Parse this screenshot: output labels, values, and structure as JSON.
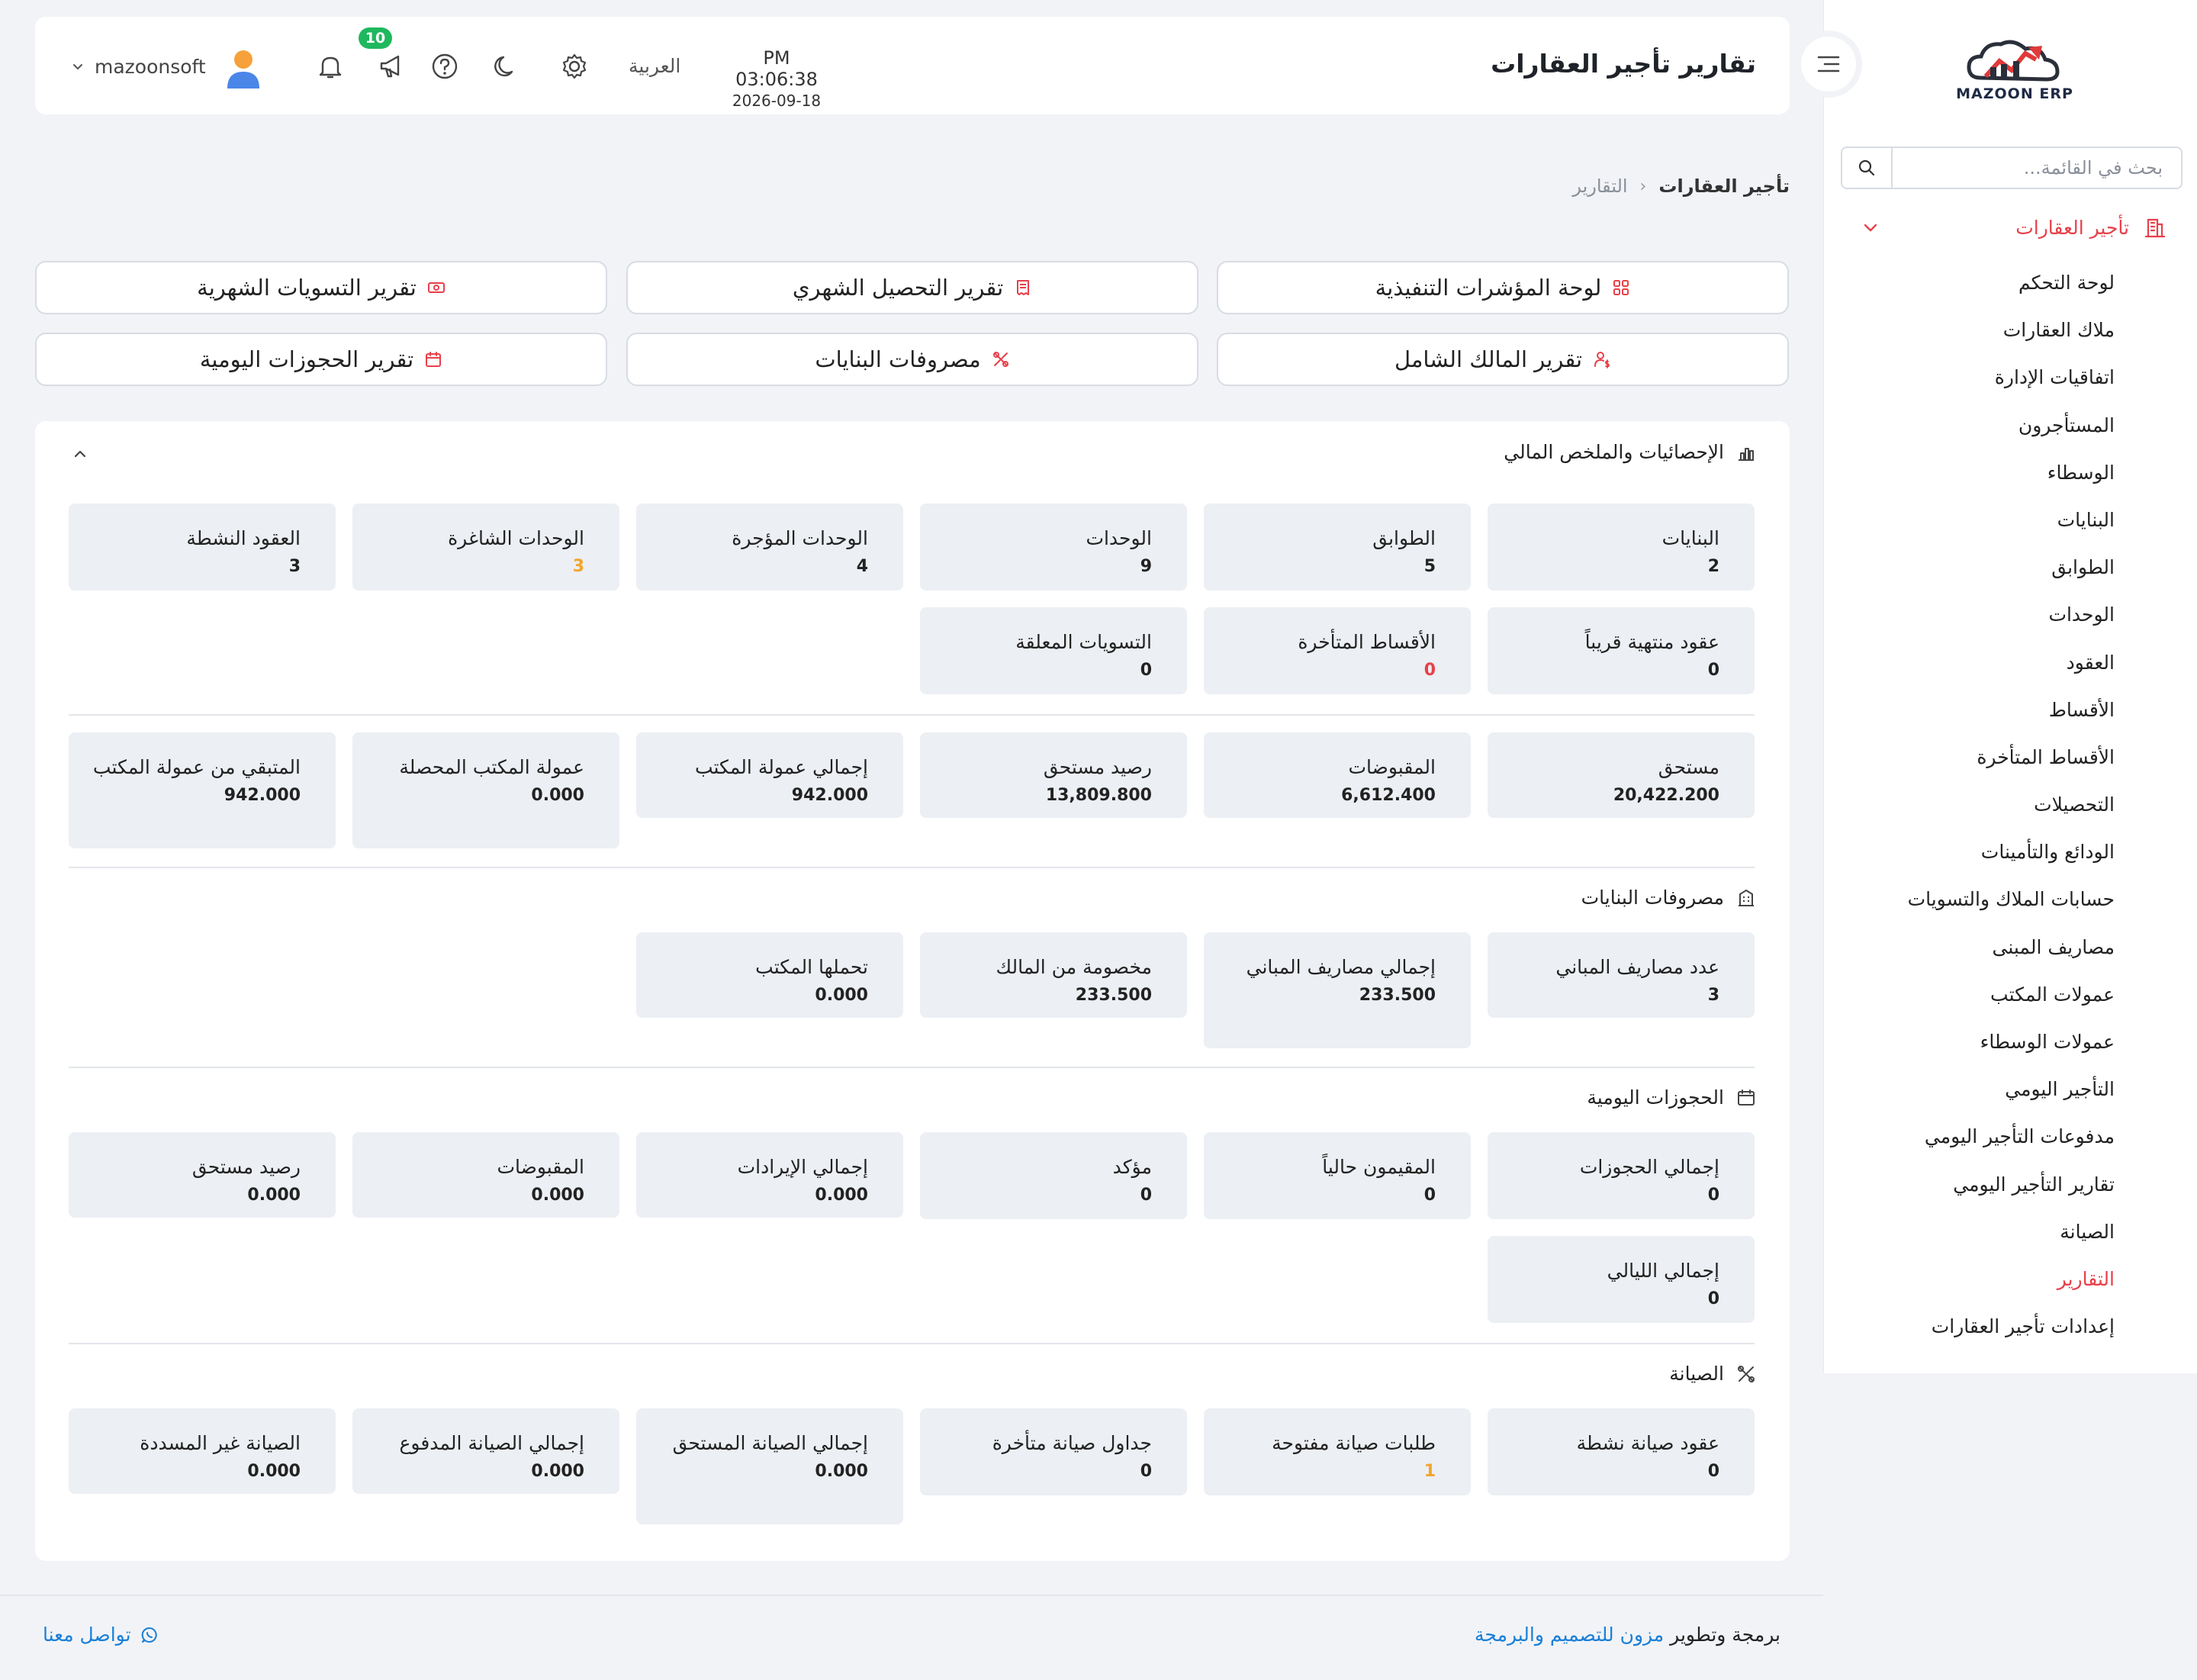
{
  "header": {
    "title": "تقارير تأجير العقارات",
    "time": "PM 03:06:38",
    "date": "2026-09-18",
    "language": "العربية",
    "notifications_count": "10",
    "username": "mazoonsoft"
  },
  "sidebar": {
    "logo_text": "MAZOON ERP",
    "search_placeholder": "بحث في القائمة...",
    "group_label": "تأجير العقارات",
    "items": [
      {
        "label": "لوحة التحكم"
      },
      {
        "label": "ملاك العقارات"
      },
      {
        "label": "اتفاقيات الإدارة"
      },
      {
        "label": "المستأجرون"
      },
      {
        "label": "الوسطاء"
      },
      {
        "label": "البنايات"
      },
      {
        "label": "الطوابق"
      },
      {
        "label": "الوحدات"
      },
      {
        "label": "العقود"
      },
      {
        "label": "الأقساط"
      },
      {
        "label": "الأقساط المتأخرة"
      },
      {
        "label": "التحصيلات"
      },
      {
        "label": "الودائع والتأمينات"
      },
      {
        "label": "حسابات الملاك والتسويات"
      },
      {
        "label": "مصاريف المبنى"
      },
      {
        "label": "عمولات المكتب"
      },
      {
        "label": "عمولات الوسطاء"
      },
      {
        "label": "التأجير اليومي"
      },
      {
        "label": "مدفوعات التأجير اليومي"
      },
      {
        "label": "تقارير التأجير اليومي"
      },
      {
        "label": "الصيانة"
      },
      {
        "label": "التقارير",
        "active": true
      },
      {
        "label": "إعدادات تأجير العقارات"
      }
    ]
  },
  "breadcrumb": {
    "parent": "تأجير العقارات",
    "separator": "‹",
    "current": "التقارير"
  },
  "report_buttons": {
    "kpi_dashboard": "لوحة المؤشرات التنفيذية",
    "monthly_collection": "تقرير التحصيل الشهري",
    "monthly_settlements": "تقرير التسويات الشهرية",
    "owner_comprehensive": "تقرير المالك الشامل",
    "building_expenses": "مصروفات البنايات",
    "daily_bookings": "تقرير الحجوزات اليومية"
  },
  "stats": {
    "title": "الإحصائيات والملخص المالي",
    "counts": [
      {
        "label": "البنايات",
        "value": "2"
      },
      {
        "label": "الطوابق",
        "value": "5"
      },
      {
        "label": "الوحدات",
        "value": "9"
      },
      {
        "label": "الوحدات المؤجرة",
        "value": "4"
      },
      {
        "label": "الوحدات الشاغرة",
        "value": "3",
        "color": "orange"
      },
      {
        "label": "العقود النشطة",
        "value": "3"
      }
    ],
    "alerts": [
      {
        "label": "عقود منتهية قريباً",
        "value": "0"
      },
      {
        "label": "الأقساط المتأخرة",
        "value": "0",
        "color": "red"
      },
      {
        "label": "التسويات المعلقة",
        "value": "0"
      }
    ],
    "financial": [
      {
        "label": "مستحق",
        "value": "20,422.200"
      },
      {
        "label": "المقبوضات",
        "value": "6,612.400"
      },
      {
        "label": "رصيد مستحق",
        "value": "13,809.800"
      },
      {
        "label": "إجمالي عمولة المكتب",
        "value": "942.000"
      },
      {
        "label": "عمولة المكتب المحصلة",
        "value": "0.000"
      },
      {
        "label": "المتبقي من عمولة المكتب",
        "value": "942.000"
      }
    ]
  },
  "building_expenses": {
    "title": "مصروفات البنايات",
    "items": [
      {
        "label": "عدد مصاريف المباني",
        "value": "3"
      },
      {
        "label": "إجمالي مصاريف المباني",
        "value": "233.500"
      },
      {
        "label": "مخصومة من المالك",
        "value": "233.500"
      },
      {
        "label": "تحملها المكتب",
        "value": "0.000"
      }
    ]
  },
  "daily_bookings": {
    "title": "الحجوزات اليومية",
    "items": [
      {
        "label": "إجمالي الحجوزات",
        "value": "0"
      },
      {
        "label": "المقيمون حالياً",
        "value": "0"
      },
      {
        "label": "مؤكد",
        "value": "0"
      },
      {
        "label": "إجمالي الإيرادات",
        "value": "0.000"
      },
      {
        "label": "المقبوضات",
        "value": "0.000"
      },
      {
        "label": "رصيد مستحق",
        "value": "0.000"
      },
      {
        "label": "إجمالي الليالي",
        "value": "0"
      }
    ]
  },
  "maintenance": {
    "title": "الصيانة",
    "items": [
      {
        "label": "عقود صيانة نشطة",
        "value": "0"
      },
      {
        "label": "طلبات صيانة مفتوحة",
        "value": "1",
        "color": "orange"
      },
      {
        "label": "جداول صيانة متأخرة",
        "value": "0"
      },
      {
        "label": "إجمالي الصيانة المستحق",
        "value": "0.000"
      },
      {
        "label": "إجمالي الصيانة المدفوع",
        "value": "0.000"
      },
      {
        "label": "الصيانة غير المسددة",
        "value": "0.000"
      }
    ]
  },
  "footer": {
    "credit_prefix": "برمجة وتطوير",
    "credit_link": "مزون للتصميم والبرمجة",
    "contact": "تواصل معنا"
  },
  "colors": {
    "accent": "#e8404a",
    "badge": "#1fb85e",
    "warning": "#f2a52d",
    "link": "#1a7fd6",
    "card_bg": "#eceff3"
  }
}
